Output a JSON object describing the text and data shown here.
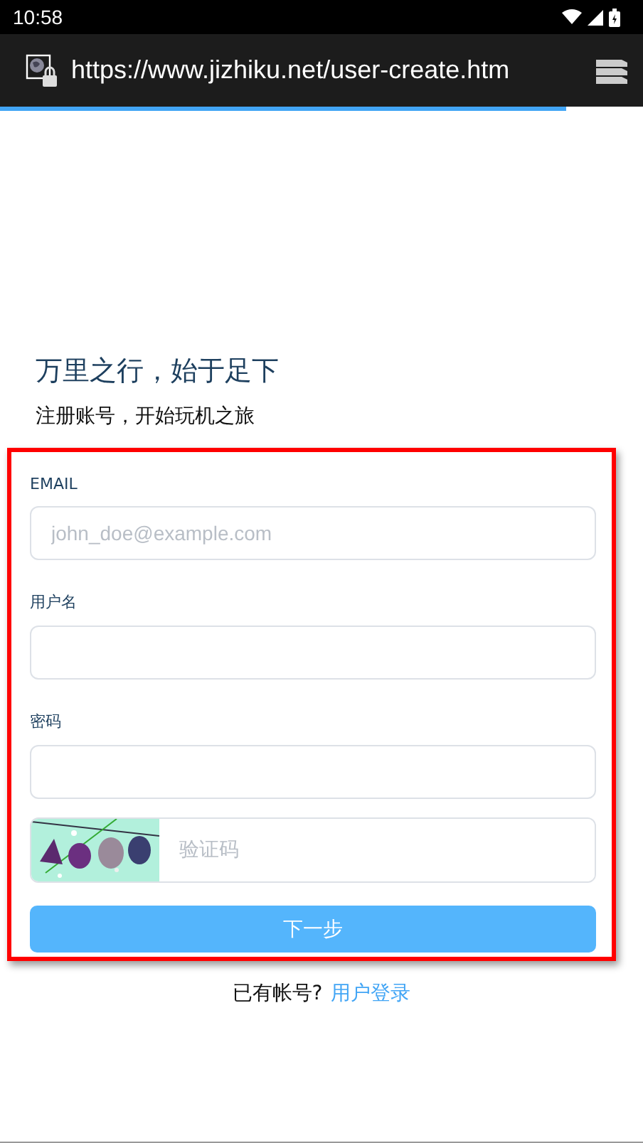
{
  "status_bar": {
    "time": "10:58"
  },
  "browser": {
    "url": "https://www.jizhiku.net/user-create.htm",
    "page_load": {
      "level": 0.88
    }
  },
  "heading": {
    "title": "万里之行，始于足下",
    "subtitle": "注册账号，开始玩机之旅"
  },
  "form": {
    "fields": [
      {
        "label": "EMAIL",
        "placeholder": "john_doe@example.com"
      },
      {
        "label": "用户名"
      },
      {
        "label": "密码"
      }
    ],
    "captcha": {
      "kind": "picture",
      "placeholder": "验证码"
    },
    "submit": "下一步"
  },
  "footer": {
    "prompt": "已有帐号?",
    "link": "用户登录"
  }
}
